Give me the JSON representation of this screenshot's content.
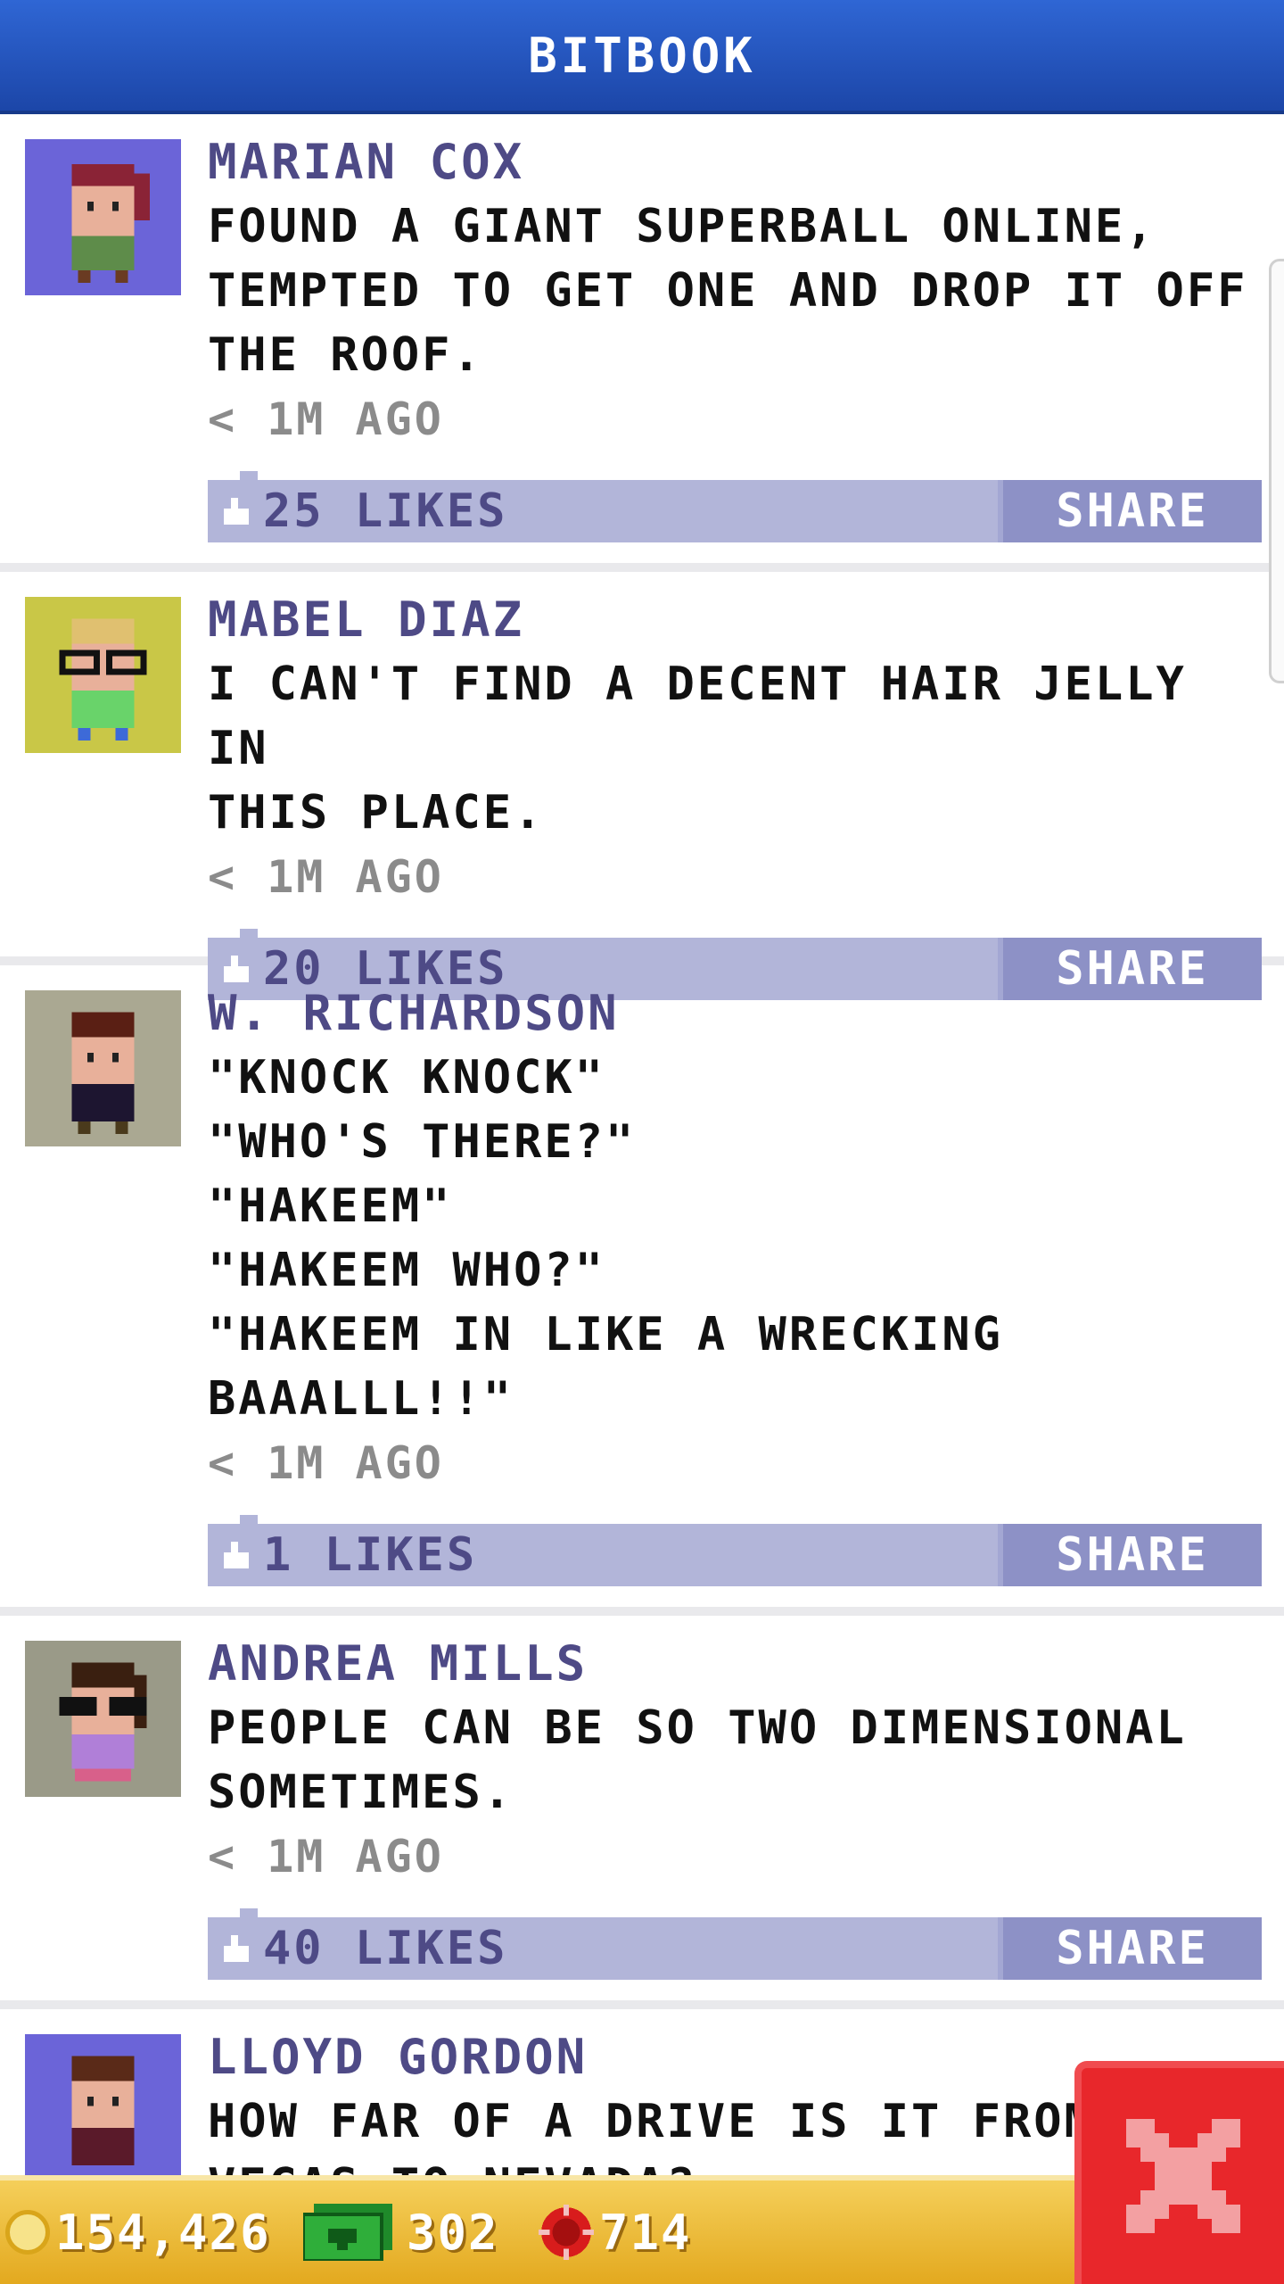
{
  "header": {
    "title": "BITBOOK"
  },
  "posts": [
    {
      "name": "MARIAN COX",
      "lines": [
        "FOUND A GIANT SUPERBALL ONLINE,",
        "TEMPTED TO GET ONE AND DROP IT OFF",
        "THE ROOF."
      ],
      "time": "< 1M AGO",
      "likes": "25 LIKES",
      "share": "SHARE",
      "avatar_bg": "#6b64d8"
    },
    {
      "name": "MABEL DIAZ",
      "lines": [
        "I CAN'T FIND A DECENT HAIR JELLY IN",
        "THIS PLACE."
      ],
      "time": "< 1M AGO",
      "likes": "20 LIKES",
      "share": "SHARE",
      "avatar_bg": "#c9c747"
    },
    {
      "name": "W. RICHARDSON",
      "lines": [
        "\"KNOCK KNOCK\"",
        "\"WHO'S THERE?\"",
        "\"HAKEEM\"",
        "\"HAKEEM WHO?\"",
        "\"HAKEEM IN LIKE A WRECKING",
        "BAAALLL!!\""
      ],
      "time": "< 1M AGO",
      "likes": "1 LIKES",
      "share": "SHARE",
      "avatar_bg": "#aaa892"
    },
    {
      "name": "ANDREA MILLS",
      "lines": [
        "PEOPLE CAN BE SO TWO DIMENSIONAL",
        "SOMETIMES."
      ],
      "time": "< 1M AGO",
      "likes": "40 LIKES",
      "share": "SHARE",
      "avatar_bg": "#9a9a88"
    },
    {
      "name": "LLOYD GORDON",
      "lines": [
        "HOW FAR OF A DRIVE IS IT FROM",
        "VEGAS TO NEVADA?"
      ],
      "time": "",
      "likes": "",
      "share": "",
      "avatar_bg": "#6b64d8"
    }
  ],
  "status_bar": {
    "coins": "154,426",
    "cash": "302",
    "chips": "714"
  },
  "colors": {
    "header_blue": "#1c46a8",
    "name_purple": "#4e4a86",
    "like_bar": "#b2b5d9",
    "share_button": "#8d91c6",
    "close_red": "#e8272b",
    "status_gold": "#e3a91f"
  },
  "icons": [
    "like-icon",
    "coin-icon",
    "cash-icon",
    "chip-icon",
    "close-icon"
  ]
}
